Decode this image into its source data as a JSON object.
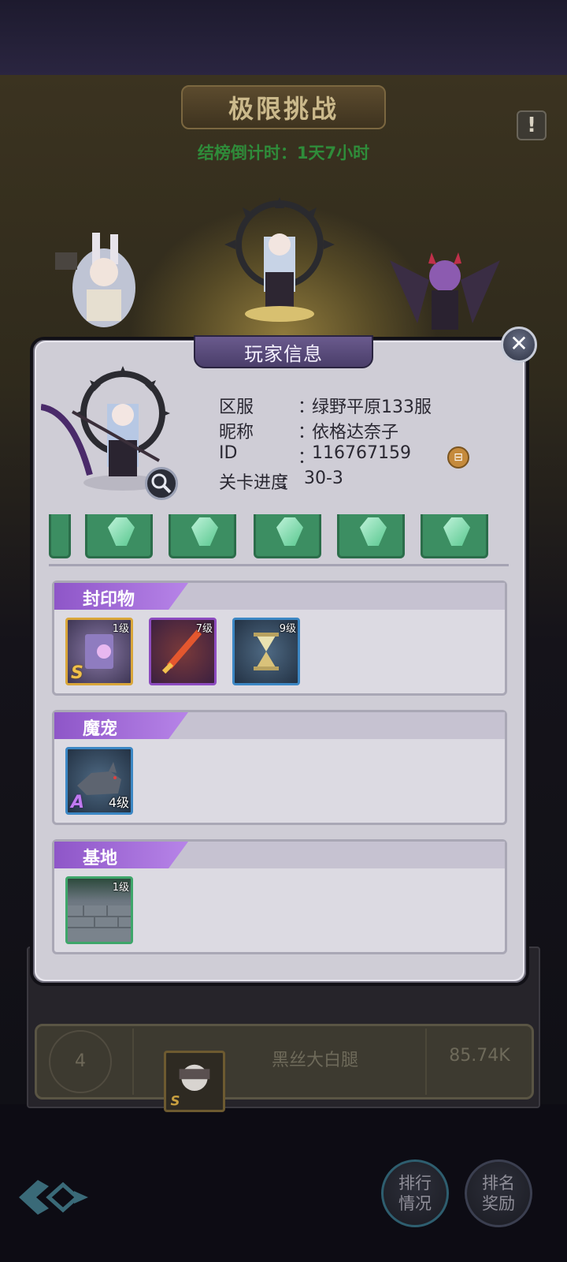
{
  "event": {
    "title": "极限挑战",
    "countdown": "结榜倒计时：1天7小时",
    "help_icon": "exclamation-icon",
    "help_glyph": "!"
  },
  "ranking": {
    "rank": "4",
    "name": "黑丝大白腿",
    "score": "85.74K"
  },
  "bottom_buttons": [
    {
      "line1": "排行",
      "line2": "情况"
    },
    {
      "line1": "排名",
      "line2": "奖励"
    }
  ],
  "modal": {
    "title": "玩家信息",
    "close_glyph": "✕",
    "info": [
      {
        "key": "区服",
        "value": "绿野平原133服"
      },
      {
        "key": "昵称",
        "value": "依格达奈子"
      },
      {
        "key": "ID",
        "value": "116767159"
      },
      {
        "key": "关卡进度",
        "value": "30-3"
      }
    ],
    "colon": "：",
    "copy_glyph": "⊟"
  },
  "sections": {
    "seals": {
      "label": "封印物",
      "items": [
        {
          "level": "1级",
          "rarity": "S",
          "icon": "spellbook-icon"
        },
        {
          "level": "7级",
          "icon": "flame-sword-icon"
        },
        {
          "level": "9级",
          "icon": "hourglass-icon"
        }
      ]
    },
    "pets": {
      "label": "魔宠",
      "items": [
        {
          "level": "4级",
          "rarity": "A",
          "icon": "wolf-icon"
        }
      ]
    },
    "base": {
      "label": "基地",
      "items": [
        {
          "level": "1级",
          "icon": "stone-wall-icon"
        }
      ]
    }
  },
  "colors": {
    "modal_bg": "#cfcdd6",
    "section_tag": "#a46ddb",
    "countdown": "#2f8c3a",
    "gem": "#3c8e62"
  }
}
